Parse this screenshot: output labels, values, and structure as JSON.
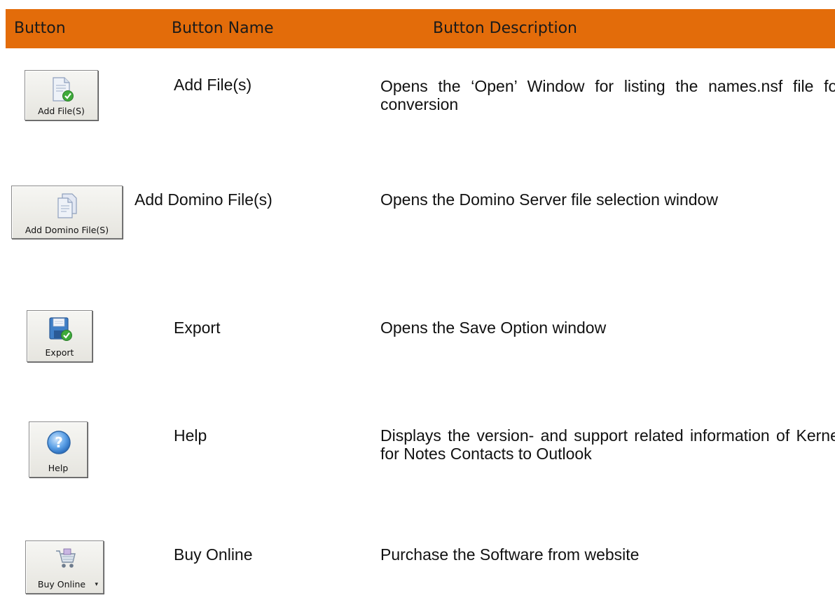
{
  "header": {
    "col_button": "Button",
    "col_name": "Button Name",
    "col_description": "Button Description",
    "color": "#e36c0a"
  },
  "rows": [
    {
      "icon": "document-check-icon",
      "caption": "Add File(S)",
      "name": "Add File(s)",
      "description": "Opens the ‘Open’ Window for listing the names.nsf file for conversion"
    },
    {
      "icon": "documents-icon",
      "caption": "Add Domino File(S)",
      "name": "Add Domino File(s)",
      "description": "Opens the Domino Server file selection window"
    },
    {
      "icon": "floppy-check-icon",
      "caption": "Export",
      "name": "Export",
      "description": "Opens the Save Option window"
    },
    {
      "icon": "help-icon",
      "caption": "Help",
      "name": "Help",
      "description": "Displays the version- and support related information of Kernel for Notes Contacts to Outlook"
    },
    {
      "icon": "shopping-cart-icon",
      "caption": "Buy Online",
      "name": "Buy Online",
      "description": "Purchase the Software from website"
    }
  ]
}
